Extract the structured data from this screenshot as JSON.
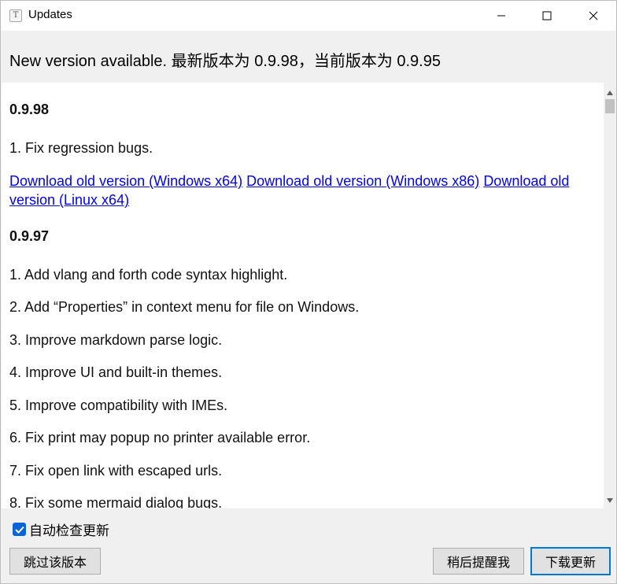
{
  "window": {
    "title": "Updates",
    "app_icon_glyph": "T",
    "controls": [
      "minimize-icon",
      "maximize-icon",
      "close-icon"
    ]
  },
  "header": {
    "text": "New version available. 最新版本为 0.9.98，当前版本为 0.9.95"
  },
  "release_notes": [
    {
      "version": "0.9.98",
      "items": [
        "1. Fix regression bugs."
      ],
      "links": [
        "Download old version (Windows x64)",
        "Download old version (Windows x86)",
        "Download old version (Linux x64)"
      ]
    },
    {
      "version": "0.9.97",
      "items": [
        "1. Add vlang and forth code syntax highlight.",
        "2. Add “Properties” in context menu for file on Windows.",
        "3. Improve markdown parse logic.",
        "4. Improve UI and built-in themes.",
        "5. Improve compatibility with IMEs.",
        "6. Fix print may popup no printer available error.",
        "7. Fix open link with escaped urls.",
        "8. Fix some mermaid dialog bugs."
      ]
    }
  ],
  "footer": {
    "auto_check_label": "自动检查更新",
    "auto_check_checked": true,
    "skip_button": "跳过该版本",
    "remind_later_button": "稍后提醒我",
    "download_button": "下载更新"
  },
  "colors": {
    "link": "#0000ee",
    "accent": "#0078d7",
    "checkbox": "#0a64d8"
  }
}
